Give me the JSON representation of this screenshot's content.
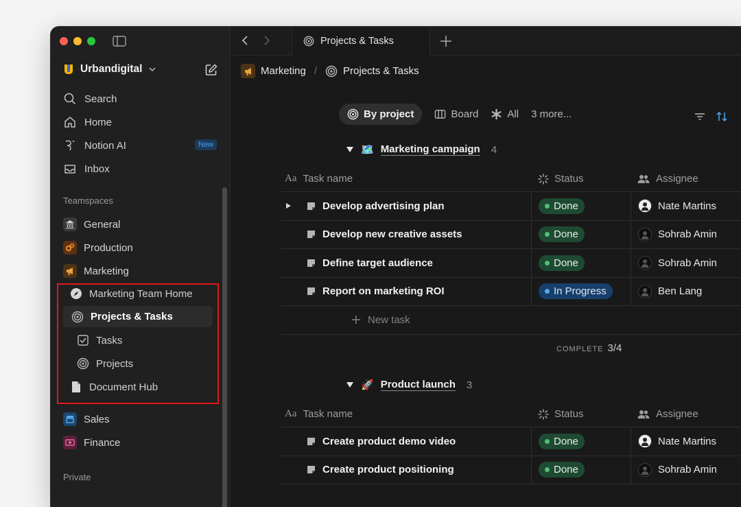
{
  "tab": {
    "title": "Projects & Tasks"
  },
  "workspace": {
    "name": "Urbandigital"
  },
  "nav": [
    {
      "label": "Search",
      "icon": "search-icon"
    },
    {
      "label": "Home",
      "icon": "home-icon"
    },
    {
      "label": "Notion AI",
      "icon": "notion-ai-icon",
      "badge": "New"
    },
    {
      "label": "Inbox",
      "icon": "inbox-icon"
    }
  ],
  "teamspaces": {
    "label": "Teamspaces",
    "items": [
      {
        "label": "General",
        "icon": "building-icon"
      },
      {
        "label": "Production",
        "icon": "gears-icon"
      },
      {
        "label": "Marketing",
        "icon": "megaphone-icon"
      }
    ],
    "marketing_children": [
      {
        "label": "Marketing Team Home",
        "icon": "compass-icon"
      },
      {
        "label": "Projects & Tasks",
        "icon": "target-icon"
      },
      {
        "label": "Tasks",
        "icon": "checkbox-icon"
      },
      {
        "label": "Projects",
        "icon": "target-icon"
      },
      {
        "label": "Document Hub",
        "icon": "document-icon"
      }
    ],
    "more": [
      {
        "label": "Sales",
        "icon": "store-icon"
      },
      {
        "label": "Finance",
        "icon": "money-icon"
      }
    ]
  },
  "private_label": "Private",
  "breadcrumb": {
    "parent": "Marketing",
    "sep": "/",
    "current": "Projects & Tasks"
  },
  "views": {
    "by_project": "By project",
    "board": "Board",
    "all": "All",
    "more": "3 more..."
  },
  "columns": {
    "task": "Task name",
    "status": "Status",
    "assignee": "Assignee"
  },
  "groups": [
    {
      "emoji": "🗺️",
      "name": "Marketing campaign",
      "count": "4",
      "rows": [
        {
          "task": "Develop advertising plan",
          "status": "Done",
          "assignee": "Nate Martins"
        },
        {
          "task": "Develop new creative assets",
          "status": "Done",
          "assignee": "Sohrab Amin"
        },
        {
          "task": "Define target audience",
          "status": "Done",
          "assignee": "Sohrab Amin"
        },
        {
          "task": "Report on marketing ROI",
          "status": "In Progress",
          "assignee": "Ben Lang"
        }
      ],
      "new_task": "New task",
      "complete_label": "COMPLETE",
      "complete_value": "3/4"
    },
    {
      "emoji": "🚀",
      "name": "Product launch",
      "count": "3",
      "rows": [
        {
          "task": "Create product demo video",
          "status": "Done",
          "assignee": "Nate Martins"
        },
        {
          "task": "Create product positioning",
          "status": "Done",
          "assignee": "Sohrab Amin"
        }
      ]
    }
  ],
  "colors": {
    "done": "#1f4a32",
    "in_progress": "#173f6b",
    "accent_blue": "#4d9cef",
    "highlight_box": "#e0191b"
  }
}
